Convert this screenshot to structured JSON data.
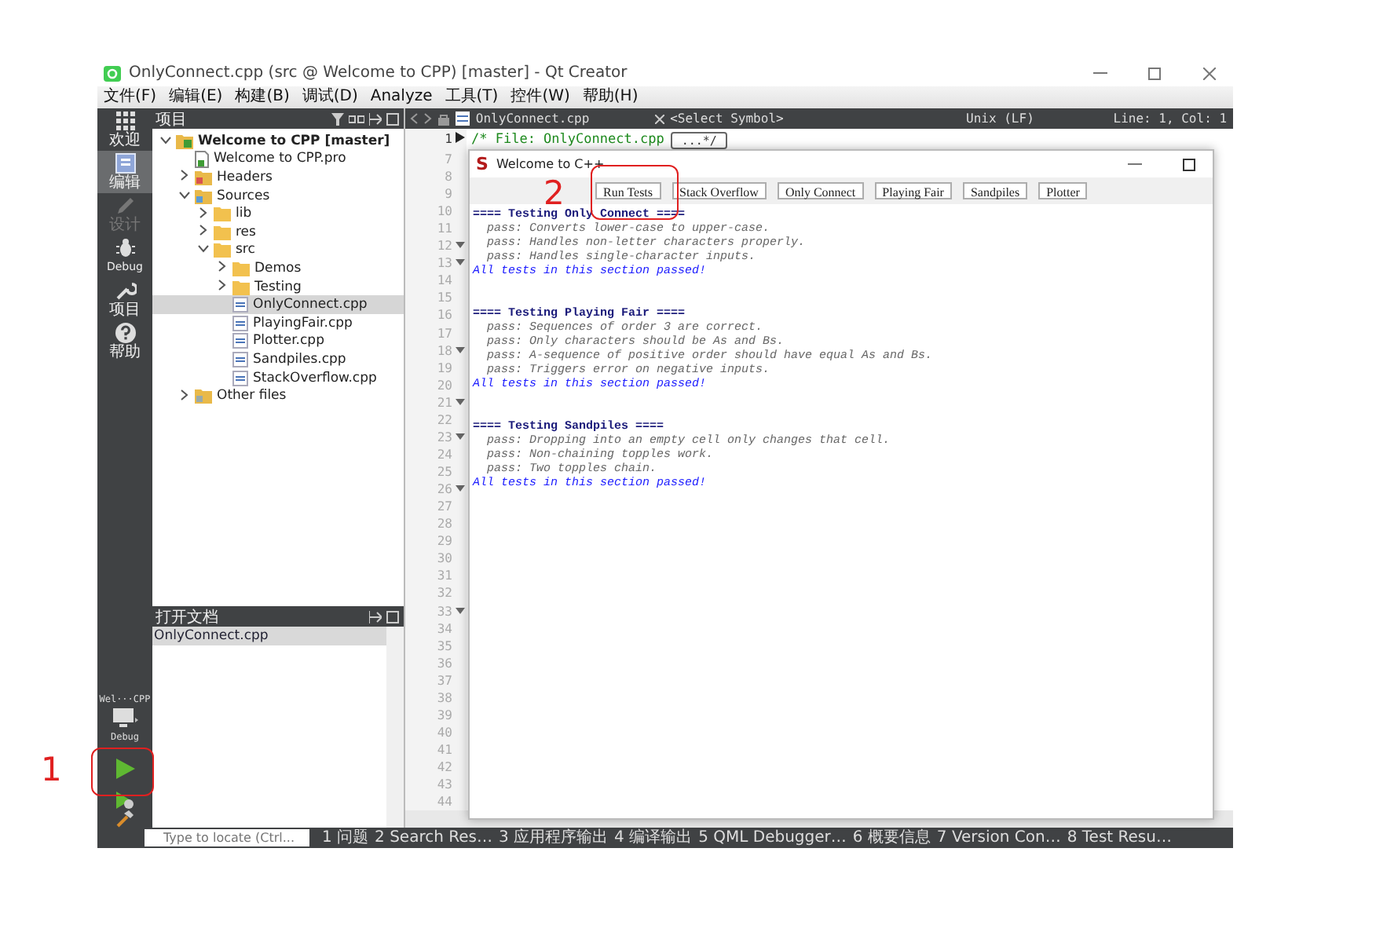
{
  "window": {
    "title": "OnlyConnect.cpp (src @ Welcome to CPP) [master] - Qt Creator"
  },
  "menu": [
    "文件(F)",
    "编辑(E)",
    "构建(B)",
    "调试(D)",
    "Analyze",
    "工具(T)",
    "控件(W)",
    "帮助(H)"
  ],
  "modes": [
    {
      "kind": "welcome",
      "label": "欢迎",
      "selected": false,
      "disabled": false
    },
    {
      "kind": "edit",
      "label": "编辑",
      "selected": true,
      "disabled": false
    },
    {
      "kind": "design",
      "label": "设计",
      "selected": false,
      "disabled": true
    },
    {
      "kind": "debug",
      "label": "Debug",
      "selected": false,
      "disabled": false
    },
    {
      "kind": "projects",
      "label": "项目",
      "selected": false,
      "disabled": false
    },
    {
      "kind": "help",
      "label": "帮助",
      "selected": false,
      "disabled": false
    }
  ],
  "kit": {
    "project": "Wel···CPP",
    "build": "Debug"
  },
  "projects": {
    "title": "项目",
    "tree": [
      {
        "kind": "project",
        "label": "Welcome to CPP [master]",
        "expanded": true,
        "selected": false,
        "children": [
          {
            "kind": "pro",
            "label": "Welcome to CPP.pro",
            "selected": false
          },
          {
            "kind": "headers",
            "label": "Headers",
            "expanded": false,
            "selected": false
          },
          {
            "kind": "sources",
            "label": "Sources",
            "expanded": true,
            "selected": false,
            "children": [
              {
                "kind": "folder",
                "label": "lib",
                "expanded": false,
                "selected": false
              },
              {
                "kind": "folder",
                "label": "res",
                "expanded": false,
                "selected": false
              },
              {
                "kind": "folder",
                "label": "src",
                "expanded": true,
                "selected": false,
                "children": [
                  {
                    "kind": "folder",
                    "label": "Demos",
                    "expanded": false,
                    "selected": false
                  },
                  {
                    "kind": "folder",
                    "label": "Testing",
                    "expanded": false,
                    "selected": false
                  },
                  {
                    "kind": "cpp",
                    "label": "OnlyConnect.cpp",
                    "selected": true
                  },
                  {
                    "kind": "cpp",
                    "label": "PlayingFair.cpp",
                    "selected": false
                  },
                  {
                    "kind": "cpp",
                    "label": "Plotter.cpp",
                    "selected": false
                  },
                  {
                    "kind": "cpp",
                    "label": "Sandpiles.cpp",
                    "selected": false
                  },
                  {
                    "kind": "cpp",
                    "label": "StackOverflow.cpp",
                    "selected": false
                  }
                ]
              }
            ]
          },
          {
            "kind": "other",
            "label": "Other files",
            "expanded": false,
            "selected": false
          }
        ]
      }
    ]
  },
  "open_documents": {
    "title": "打开文档",
    "items": [
      {
        "label": "OnlyConnect.cpp",
        "selected": true
      }
    ]
  },
  "editor": {
    "file": "OnlyConnect.cpp",
    "symbol": "<Select Symbol>",
    "line_ending": "Unix (LF)",
    "position": "Line: 1, Col: 1",
    "first_line": "/* File: OnlyConnect.cpp",
    "folded_text": "...*/",
    "line_numbers": [
      {
        "number": "1",
        "foldable": true,
        "folded": true
      },
      {
        "number": "7",
        "foldable": false
      },
      {
        "number": "8",
        "foldable": false
      },
      {
        "number": "9",
        "foldable": false
      },
      {
        "number": "10",
        "foldable": false
      },
      {
        "number": "11",
        "foldable": false
      },
      {
        "number": "12",
        "foldable": true,
        "folded": false
      },
      {
        "number": "13",
        "foldable": true,
        "folded": false
      },
      {
        "number": "14",
        "foldable": false
      },
      {
        "number": "15",
        "foldable": false
      },
      {
        "number": "16",
        "foldable": false
      },
      {
        "number": "17",
        "foldable": false
      },
      {
        "number": "18",
        "foldable": true,
        "folded": false
      },
      {
        "number": "19",
        "foldable": false
      },
      {
        "number": "20",
        "foldable": false
      },
      {
        "number": "21",
        "foldable": true,
        "folded": false
      },
      {
        "number": "22",
        "foldable": false
      },
      {
        "number": "23",
        "foldable": true,
        "folded": false
      },
      {
        "number": "24",
        "foldable": false
      },
      {
        "number": "25",
        "foldable": false
      },
      {
        "number": "26",
        "foldable": true,
        "folded": false
      },
      {
        "number": "27",
        "foldable": false
      },
      {
        "number": "28",
        "foldable": false
      },
      {
        "number": "29",
        "foldable": false
      },
      {
        "number": "30",
        "foldable": false
      },
      {
        "number": "31",
        "foldable": false
      },
      {
        "number": "32",
        "foldable": false
      },
      {
        "number": "33",
        "foldable": true,
        "folded": false
      },
      {
        "number": "34",
        "foldable": false
      },
      {
        "number": "35",
        "foldable": false
      },
      {
        "number": "36",
        "foldable": false
      },
      {
        "number": "37",
        "foldable": false
      },
      {
        "number": "38",
        "foldable": false
      },
      {
        "number": "39",
        "foldable": false
      },
      {
        "number": "40",
        "foldable": false
      },
      {
        "number": "41",
        "foldable": false
      },
      {
        "number": "42",
        "foldable": false
      },
      {
        "number": "43",
        "foldable": false
      },
      {
        "number": "44",
        "foldable": false
      }
    ]
  },
  "app_window": {
    "logo": "S",
    "title": "Welcome to C++",
    "buttons": [
      "Run Tests",
      "Stack Overflow",
      "Only Connect",
      "Playing Fair",
      "Sandpiles",
      "Plotter"
    ],
    "sections": [
      {
        "title": "==== Testing Only Connect ====",
        "results": [
          "pass: Converts lower-case to upper-case.",
          "pass: Handles non-letter characters properly.",
          "pass: Handles single-character inputs."
        ],
        "summary": "All tests in this section passed!"
      },
      {
        "title": "==== Testing Playing Fair ====",
        "results": [
          "pass: Sequences of order 3 are correct.",
          "pass: Only characters should be As and Bs.",
          "pass: A-sequence of positive order should have equal As and Bs.",
          "pass: Triggers error on negative inputs."
        ],
        "summary": "All tests in this section passed!"
      },
      {
        "title": "==== Testing Sandpiles ====",
        "results": [
          "pass: Dropping into an empty cell only changes that cell.",
          "pass: Non-chaining topples work.",
          "pass: Two topples chain."
        ],
        "summary": "All tests in this section passed!"
      }
    ]
  },
  "locator": {
    "placeholder": "Type to locate (Ctrl..."
  },
  "output_tabs": [
    "1 问题",
    "2 Search Res…",
    "3 应用程序输出",
    "4 编译输出",
    "5 QML Debugger…",
    "6 概要信息",
    "7 Version Con…",
    "8 Test Resu…"
  ],
  "annotations": [
    {
      "label": "1"
    },
    {
      "label": "2"
    }
  ]
}
